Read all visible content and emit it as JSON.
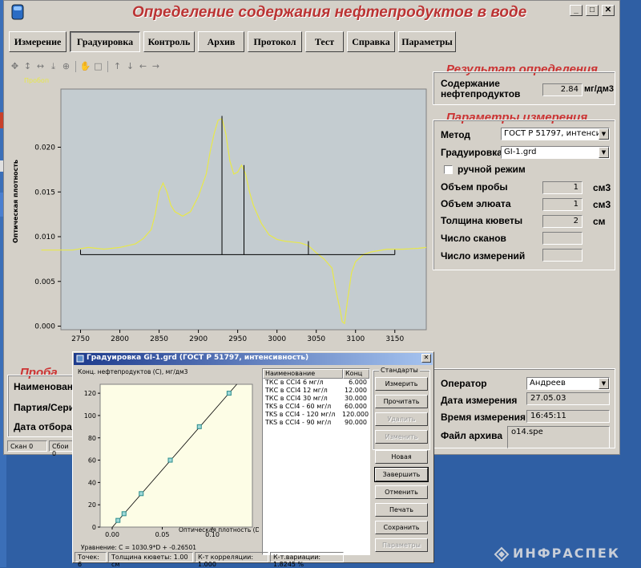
{
  "window": {
    "title": "Определение содержания нефтепродуктов в воде",
    "min": "_",
    "max": "□",
    "close": "✕"
  },
  "menu": [
    {
      "label": "Измерение"
    },
    {
      "label": "Градуировка"
    },
    {
      "label": "Контроль"
    },
    {
      "label": "Архив"
    },
    {
      "label": "Протокол"
    },
    {
      "label": "Тест"
    },
    {
      "label": "Справка"
    },
    {
      "label": "Параметры"
    }
  ],
  "main_chart": {
    "legend_label": "Пробоп",
    "ylabel": "Оптическая плотность"
  },
  "chart_data": [
    {
      "type": "line",
      "series": [
        {
          "name": "Пробоп",
          "color": "#e8e84a",
          "x": [
            2700,
            2740,
            2760,
            2780,
            2800,
            2810,
            2820,
            2830,
            2840,
            2845,
            2850,
            2855,
            2860,
            2865,
            2870,
            2880,
            2890,
            2900,
            2910,
            2915,
            2920,
            2925,
            2930,
            2935,
            2940,
            2945,
            2950,
            2955,
            2960,
            2965,
            2970,
            2980,
            2990,
            3000,
            3010,
            3020,
            3030,
            3040,
            3050,
            3060,
            3070,
            3075,
            3080,
            3083,
            3086,
            3090,
            3095,
            3100,
            3110,
            3120,
            3140,
            3160,
            3180,
            3190
          ],
          "y": [
            0.0085,
            0.0085,
            0.0088,
            0.0086,
            0.0088,
            0.009,
            0.0092,
            0.0098,
            0.0108,
            0.0125,
            0.015,
            0.016,
            0.015,
            0.0135,
            0.0128,
            0.0123,
            0.0128,
            0.0145,
            0.017,
            0.0195,
            0.0215,
            0.023,
            0.0232,
            0.0215,
            0.0185,
            0.017,
            0.0172,
            0.018,
            0.017,
            0.015,
            0.0135,
            0.0115,
            0.0102,
            0.0097,
            0.0095,
            0.0094,
            0.0093,
            0.009,
            0.0082,
            0.0075,
            0.0065,
            0.004,
            0.002,
            0.0005,
            0.0003,
            0.003,
            0.006,
            0.0072,
            0.008,
            0.0083,
            0.0086,
            0.0086,
            0.0087,
            0.0088
          ]
        }
      ],
      "vlines": [
        {
          "x": 2930,
          "y": 0.0235
        },
        {
          "x": 2958,
          "y": 0.018
        },
        {
          "x": 3040,
          "y": 0.0095
        }
      ],
      "baseline": {
        "x": [
          2750,
          3150
        ],
        "y": 0.008
      },
      "x_ticks": [
        "2750",
        "2800",
        "2850",
        "2900",
        "2950",
        "3000",
        "3050",
        "3100",
        "3150"
      ],
      "y_ticks": [
        "0.000",
        "0.005",
        "0.010",
        "0.015",
        "0.020"
      ],
      "xlim": [
        2725,
        3190
      ],
      "ylim": [
        -0.0004,
        0.0265
      ],
      "ylabel": "Оптическая плотность",
      "grid": false
    },
    {
      "type": "scatter",
      "title": "Конц. нефтепродуктов (C), мг/дм3",
      "xlabel": "Оптическая плотность (D)",
      "x": [
        0.0058,
        0.0118,
        0.029,
        0.058,
        0.087,
        0.1167
      ],
      "y": [
        6,
        12,
        30,
        60,
        90,
        120
      ],
      "fit": {
        "slope": 1030.9,
        "intercept": -0.26501
      },
      "x_ticks": [
        "0.00",
        "0.05",
        "0.10"
      ],
      "y_ticks": [
        "0",
        "20",
        "40",
        "60",
        "80",
        "100",
        "120"
      ],
      "xlim": [
        -0.012,
        0.14
      ],
      "ylim": [
        0,
        128
      ],
      "grid": false
    }
  ],
  "result": {
    "title": "Результат определения",
    "label": "Содержание нефтепродуктов",
    "label_line1": "Содержание",
    "label_line2": "нефтепродуктов",
    "value": "2.84",
    "unit": "мг/дм3"
  },
  "params": {
    "title": "Параметры измерения",
    "method_label": "Метод",
    "method_value": "ГОСТ Р 51797, интенсивнос",
    "calib_label": "Градуировка",
    "calib_value": "GI-1.grd",
    "manual_label": "ручной режим",
    "sample_volume_label": "Объем пробы",
    "sample_volume_value": "1",
    "sample_volume_unit": "см3",
    "eluate_volume_label": "Объем элюата",
    "eluate_volume_value": "1",
    "eluate_volume_unit": "см3",
    "cuvette_label": "Толщина кюветы",
    "cuvette_value": "2",
    "cuvette_unit": "см",
    "scans_label": "Число сканов",
    "measurements_label": "Число измерений"
  },
  "sample": {
    "title": "Проба",
    "name_label": "Наименовани",
    "batch_label": "Партия/Сери",
    "date_label": "Дата отбора"
  },
  "operator": {
    "operator_label": "Оператор",
    "operator_value": "Андреев",
    "date_label": "Дата измерения",
    "date_value": "27.05.03",
    "time_label": "Время измерения",
    "time_value": "16:45:11",
    "file_label": "Файл архива",
    "file_value": "o14.spe"
  },
  "status": {
    "scan": "Скан 0",
    "fail": "Сбои 0"
  },
  "dialog": {
    "title": "Градуировка  GI-1.grd (ГОСТ Р 51797, интенсивность)",
    "close": "✕",
    "equation": "Уравнение:  C = 1030.9*D + -0.26501",
    "table_headers": [
      "Наименование",
      "Конц"
    ],
    "rows": [
      {
        "name": "ТКС в CCl4 6 мг/л",
        "conc": "6.000"
      },
      {
        "name": "ТКС в CCl4 12 мг/л",
        "conc": "12.000"
      },
      {
        "name": "ТКС в CCl4 30 мг/л",
        "conc": "30.000"
      },
      {
        "name": "TKS в CCl4 - 60 мг/л",
        "conc": "60.000"
      },
      {
        "name": "TKS в CCl4 - 120 мг/л",
        "conc": "120.000"
      },
      {
        "name": "TKS в CCl4 - 90 мг/л",
        "conc": "90.000"
      }
    ],
    "standards_label": "Стандарты",
    "buttons": {
      "measure": "Измерить",
      "read": "Прочитать",
      "delete": "Удалить",
      "change": "Изменить",
      "new": "Новая",
      "finish": "Завершить",
      "cancel": "Отменить",
      "print": "Печать",
      "save": "Сохранить",
      "params": "Параметры"
    },
    "status": {
      "points": "Точек: 6",
      "cuvette": "Толщина кюветы: 1.00 см",
      "correlation": "К-т корреляции: 1.000",
      "variation": "К-т.вариации: 1.8245 %"
    }
  },
  "watermark": "ИНФРАСПЕК",
  "colors": {
    "title_red": "#b33333",
    "plot_bg": "#c4ccd0",
    "spectrum": "#e8e84a",
    "calib_bg": "#fdfde6",
    "point": "#2a8c8c",
    "desktop": "#2f5fa4"
  }
}
